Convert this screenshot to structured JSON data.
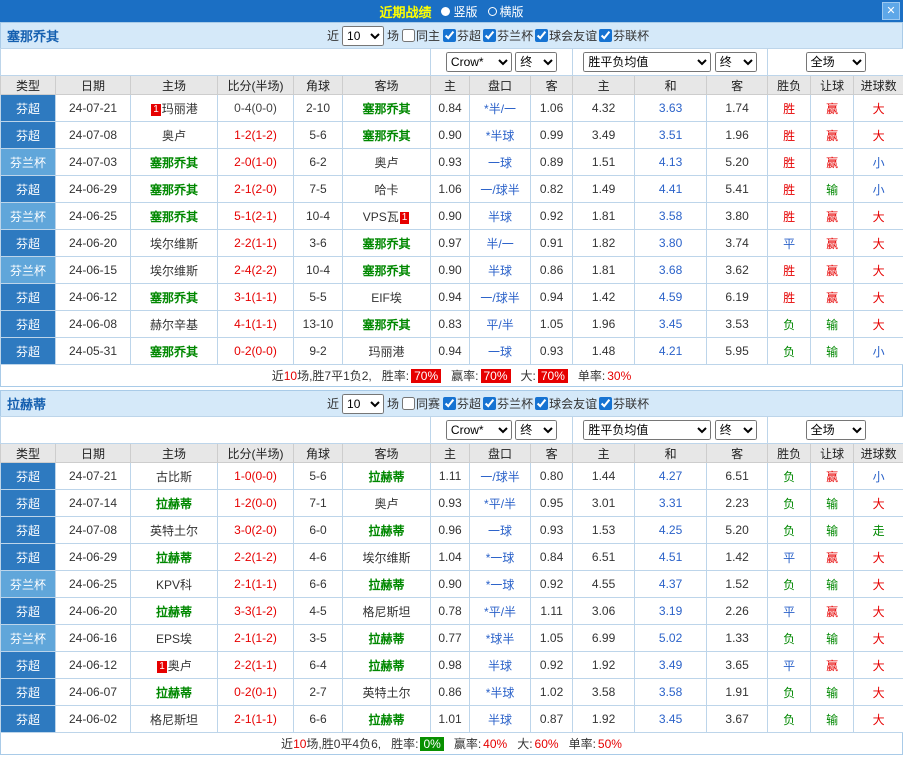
{
  "colors": {
    "accent": "#1b6fc4",
    "title": "#ffff00",
    "win": "#e60000",
    "draw": "#2b62c9",
    "lose": "#008800",
    "team": "#008800",
    "badge": "#e60000",
    "league_dark": "#2e7ac0",
    "league_light": "#60a6da"
  },
  "titlebar": {
    "title": "近期战绩",
    "options": [
      {
        "label": "竖版",
        "selected": true
      },
      {
        "label": "横版",
        "selected": false
      }
    ],
    "close": "✕"
  },
  "sections": [
    {
      "team": "塞那乔其",
      "filter": {
        "near": "近",
        "count": "10",
        "games": "场",
        "same": {
          "label": "同主",
          "checked": false
        },
        "leagues": [
          {
            "label": "芬超",
            "checked": true
          },
          {
            "label": "芬兰杯",
            "checked": true
          },
          {
            "label": "球会友谊",
            "checked": true
          },
          {
            "label": "芬联杯",
            "checked": true
          }
        ]
      },
      "controls": {
        "company": "Crow*",
        "final1": "终",
        "avg": "胜平负均值",
        "final2": "终",
        "scope": "全场"
      },
      "headers": [
        "类型",
        "日期",
        "主场",
        "比分(半场)",
        "角球",
        "客场",
        "主",
        "盘口",
        "客",
        "主",
        "和",
        "客",
        "胜负",
        "让球",
        "进球数"
      ],
      "rows": [
        {
          "league": "芬超",
          "league_tone": "dark",
          "date": "24-07-21",
          "home": {
            "pre": "1",
            "name": "玛丽港",
            "self": false
          },
          "score": "0-4(0-0)",
          "score_muted": true,
          "corner": "2-10",
          "away": {
            "name": "塞那乔其",
            "self": true
          },
          "o1": "0.84",
          "hc": "*半/一",
          "o2": "1.06",
          "a1": "4.32",
          "a2": "3.63",
          "a3": "1.74",
          "r": "胜",
          "hr": "赢",
          "g": "大"
        },
        {
          "league": "芬超",
          "league_tone": "dark",
          "date": "24-07-08",
          "home": {
            "name": "奥卢",
            "self": false
          },
          "score": "1-2(1-2)",
          "corner": "5-6",
          "away": {
            "name": "塞那乔其",
            "self": true
          },
          "o1": "0.90",
          "hc": "*半球",
          "o2": "0.99",
          "a1": "3.49",
          "a2": "3.51",
          "a3": "1.96",
          "r": "胜",
          "hr": "赢",
          "g": "大"
        },
        {
          "league": "芬兰杯",
          "league_tone": "light",
          "date": "24-07-03",
          "home": {
            "name": "塞那乔其",
            "self": true
          },
          "score": "2-0(1-0)",
          "corner": "6-2",
          "away": {
            "name": "奥卢",
            "self": false
          },
          "o1": "0.93",
          "hc": "一球",
          "o2": "0.89",
          "a1": "1.51",
          "a2": "4.13",
          "a3": "5.20",
          "r": "胜",
          "hr": "赢",
          "g": "小"
        },
        {
          "league": "芬超",
          "league_tone": "dark",
          "date": "24-06-29",
          "home": {
            "name": "塞那乔其",
            "self": true
          },
          "score": "2-1(2-0)",
          "corner": "7-5",
          "away": {
            "name": "哈卡",
            "self": false
          },
          "o1": "1.06",
          "hc": "一/球半",
          "o2": "0.82",
          "a1": "1.49",
          "a2": "4.41",
          "a3": "5.41",
          "r": "胜",
          "hr": "输",
          "g": "小"
        },
        {
          "league": "芬兰杯",
          "league_tone": "light",
          "date": "24-06-25",
          "home": {
            "name": "塞那乔其",
            "self": true
          },
          "score": "5-1(2-1)",
          "corner": "10-4",
          "away": {
            "name": "VPS瓦",
            "post": "1",
            "self": false
          },
          "o1": "0.90",
          "hc": "半球",
          "o2": "0.92",
          "a1": "1.81",
          "a2": "3.58",
          "a3": "3.80",
          "r": "胜",
          "hr": "赢",
          "g": "大"
        },
        {
          "league": "芬超",
          "league_tone": "dark",
          "date": "24-06-20",
          "home": {
            "name": "埃尔维斯",
            "self": false
          },
          "score": "2-2(1-1)",
          "corner": "3-6",
          "away": {
            "name": "塞那乔其",
            "self": true
          },
          "o1": "0.97",
          "hc": "半/一",
          "o2": "0.91",
          "a1": "1.82",
          "a2": "3.80",
          "a3": "3.74",
          "r": "平",
          "hr": "赢",
          "g": "大"
        },
        {
          "league": "芬兰杯",
          "league_tone": "light",
          "date": "24-06-15",
          "home": {
            "name": "埃尔维斯",
            "self": false
          },
          "score": "2-4(2-2)",
          "corner": "10-4",
          "away": {
            "name": "塞那乔其",
            "self": true
          },
          "o1": "0.90",
          "hc": "半球",
          "o2": "0.86",
          "a1": "1.81",
          "a2": "3.68",
          "a3": "3.62",
          "r": "胜",
          "hr": "赢",
          "g": "大"
        },
        {
          "league": "芬超",
          "league_tone": "dark",
          "date": "24-06-12",
          "home": {
            "name": "塞那乔其",
            "self": true
          },
          "score": "3-1(1-1)",
          "corner": "5-5",
          "away": {
            "name": "EIF埃",
            "self": false
          },
          "o1": "0.94",
          "hc": "一/球半",
          "o2": "0.94",
          "a1": "1.42",
          "a2": "4.59",
          "a3": "6.19",
          "r": "胜",
          "hr": "赢",
          "g": "大"
        },
        {
          "league": "芬超",
          "league_tone": "dark",
          "date": "24-06-08",
          "home": {
            "name": "赫尔辛基",
            "self": false
          },
          "score": "4-1(1-1)",
          "corner": "13-10",
          "away": {
            "name": "塞那乔其",
            "self": true
          },
          "o1": "0.83",
          "hc": "平/半",
          "o2": "1.05",
          "a1": "1.96",
          "a2": "3.45",
          "a3": "3.53",
          "r": "负",
          "hr": "输",
          "g": "大"
        },
        {
          "league": "芬超",
          "league_tone": "dark",
          "date": "24-05-31",
          "home": {
            "name": "塞那乔其",
            "self": true
          },
          "score": "0-2(0-0)",
          "corner": "9-2",
          "away": {
            "name": "玛丽港",
            "self": false
          },
          "o1": "0.94",
          "hc": "一球",
          "o2": "0.93",
          "a1": "1.48",
          "a2": "4.21",
          "a3": "5.95",
          "r": "负",
          "hr": "输",
          "g": "小"
        }
      ],
      "summary": {
        "prefix": "近",
        "count": "10",
        "record": "场,胜7平1负2,",
        "items": [
          {
            "label": "胜率:",
            "value": "70%",
            "badge": true,
            "color": "#e60000"
          },
          {
            "label": "赢率:",
            "value": "70%",
            "badge": true,
            "color": "#e60000"
          },
          {
            "label": "大:",
            "value": "70%",
            "badge": true,
            "color": "#e60000"
          },
          {
            "label": "单率:",
            "value": "30%",
            "badge": false,
            "color": "#e60000"
          }
        ]
      }
    },
    {
      "team": "拉赫蒂",
      "filter": {
        "near": "近",
        "count": "10",
        "games": "场",
        "same": {
          "label": "同赛",
          "checked": false
        },
        "leagues": [
          {
            "label": "芬超",
            "checked": true
          },
          {
            "label": "芬兰杯",
            "checked": true
          },
          {
            "label": "球会友谊",
            "checked": true
          },
          {
            "label": "芬联杯",
            "checked": true
          }
        ]
      },
      "controls": {
        "company": "Crow*",
        "final1": "终",
        "avg": "胜平负均值",
        "final2": "终",
        "scope": "全场"
      },
      "headers": [
        "类型",
        "日期",
        "主场",
        "比分(半场)",
        "角球",
        "客场",
        "主",
        "盘口",
        "客",
        "主",
        "和",
        "客",
        "胜负",
        "让球",
        "进球数"
      ],
      "rows": [
        {
          "league": "芬超",
          "league_tone": "dark",
          "date": "24-07-21",
          "home": {
            "name": "古比斯",
            "self": false
          },
          "score": "1-0(0-0)",
          "corner": "5-6",
          "away": {
            "name": "拉赫蒂",
            "self": true
          },
          "o1": "1.11",
          "hc": "一/球半",
          "o2": "0.80",
          "a1": "1.44",
          "a2": "4.27",
          "a3": "6.51",
          "r": "负",
          "hr": "赢",
          "g": "小"
        },
        {
          "league": "芬超",
          "league_tone": "dark",
          "date": "24-07-14",
          "home": {
            "name": "拉赫蒂",
            "self": true
          },
          "score": "1-2(0-0)",
          "corner": "7-1",
          "away": {
            "name": "奥卢",
            "self": false
          },
          "o1": "0.93",
          "hc": "*平/半",
          "o2": "0.95",
          "a1": "3.01",
          "a2": "3.31",
          "a3": "2.23",
          "r": "负",
          "hr": "输",
          "g": "大"
        },
        {
          "league": "芬超",
          "league_tone": "dark",
          "date": "24-07-08",
          "home": {
            "name": "英特土尔",
            "self": false
          },
          "score": "3-0(2-0)",
          "corner": "6-0",
          "away": {
            "name": "拉赫蒂",
            "self": true
          },
          "o1": "0.96",
          "hc": "一球",
          "o2": "0.93",
          "a1": "1.53",
          "a2": "4.25",
          "a3": "5.20",
          "r": "负",
          "hr": "输",
          "g": "走"
        },
        {
          "league": "芬超",
          "league_tone": "dark",
          "date": "24-06-29",
          "home": {
            "name": "拉赫蒂",
            "self": true
          },
          "score": "2-2(1-2)",
          "corner": "4-6",
          "away": {
            "name": "埃尔维斯",
            "self": false
          },
          "o1": "1.04",
          "hc": "*一球",
          "o2": "0.84",
          "a1": "6.51",
          "a2": "4.51",
          "a3": "1.42",
          "r": "平",
          "hr": "赢",
          "g": "大"
        },
        {
          "league": "芬兰杯",
          "league_tone": "light",
          "date": "24-06-25",
          "home": {
            "name": "KPV科",
            "self": false
          },
          "score": "2-1(1-1)",
          "corner": "6-6",
          "away": {
            "name": "拉赫蒂",
            "self": true
          },
          "o1": "0.90",
          "hc": "*一球",
          "o2": "0.92",
          "a1": "4.55",
          "a2": "4.37",
          "a3": "1.52",
          "r": "负",
          "hr": "输",
          "g": "大"
        },
        {
          "league": "芬超",
          "league_tone": "dark",
          "date": "24-06-20",
          "home": {
            "name": "拉赫蒂",
            "self": true
          },
          "score": "3-3(1-2)",
          "corner": "4-5",
          "away": {
            "name": "格尼斯坦",
            "self": false
          },
          "o1": "0.78",
          "hc": "*平/半",
          "o2": "1.11",
          "a1": "3.06",
          "a2": "3.19",
          "a3": "2.26",
          "r": "平",
          "hr": "赢",
          "g": "大"
        },
        {
          "league": "芬兰杯",
          "league_tone": "light",
          "date": "24-06-16",
          "home": {
            "name": "EPS埃",
            "self": false
          },
          "score": "2-1(1-2)",
          "corner": "3-5",
          "away": {
            "name": "拉赫蒂",
            "self": true
          },
          "o1": "0.77",
          "hc": "*球半",
          "o2": "1.05",
          "a1": "6.99",
          "a2": "5.02",
          "a3": "1.33",
          "r": "负",
          "hr": "输",
          "g": "大"
        },
        {
          "league": "芬超",
          "league_tone": "dark",
          "date": "24-06-12",
          "home": {
            "pre": "1",
            "name": "奥卢",
            "self": false
          },
          "score": "2-2(1-1)",
          "corner": "6-4",
          "away": {
            "name": "拉赫蒂",
            "self": true
          },
          "o1": "0.98",
          "hc": "半球",
          "o2": "0.92",
          "a1": "1.92",
          "a2": "3.49",
          "a3": "3.65",
          "r": "平",
          "hr": "赢",
          "g": "大"
        },
        {
          "league": "芬超",
          "league_tone": "dark",
          "date": "24-06-07",
          "home": {
            "name": "拉赫蒂",
            "self": true
          },
          "score": "0-2(0-1)",
          "corner": "2-7",
          "away": {
            "name": "英特土尔",
            "self": false
          },
          "o1": "0.86",
          "hc": "*半球",
          "o2": "1.02",
          "a1": "3.58",
          "a2": "3.58",
          "a3": "1.91",
          "r": "负",
          "hr": "输",
          "g": "大"
        },
        {
          "league": "芬超",
          "league_tone": "dark",
          "date": "24-06-02",
          "home": {
            "name": "格尼斯坦",
            "self": false
          },
          "score": "2-1(1-1)",
          "corner": "6-6",
          "away": {
            "name": "拉赫蒂",
            "self": true
          },
          "o1": "1.01",
          "hc": "半球",
          "o2": "0.87",
          "a1": "1.92",
          "a2": "3.45",
          "a3": "3.67",
          "r": "负",
          "hr": "输",
          "g": "大"
        }
      ],
      "summary": {
        "prefix": "近",
        "count": "10",
        "record": "场,胜0平4负6,",
        "items": [
          {
            "label": "胜率:",
            "value": "0%",
            "badge": true,
            "color": "#089000"
          },
          {
            "label": "赢率:",
            "value": "40%",
            "badge": false,
            "color": "#e60000"
          },
          {
            "label": "大:",
            "value": "60%",
            "badge": false,
            "color": "#e60000"
          },
          {
            "label": "单率:",
            "value": "50%",
            "badge": false,
            "color": "#e60000"
          }
        ]
      }
    }
  ]
}
